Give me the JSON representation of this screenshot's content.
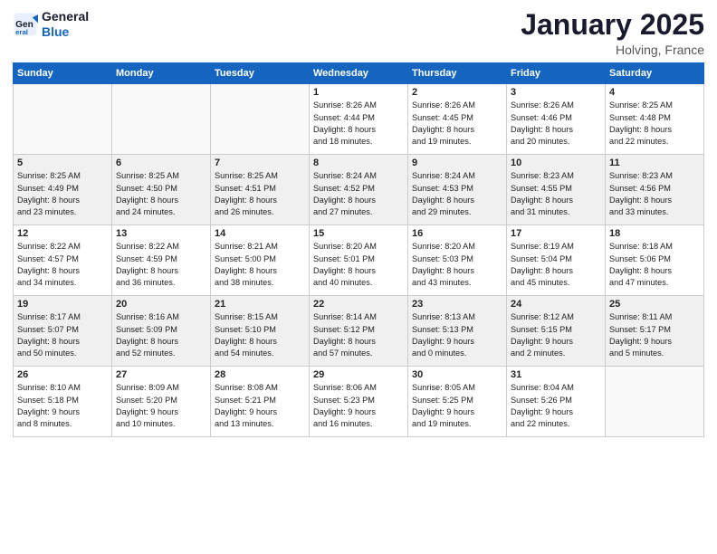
{
  "logo": {
    "line1": "General",
    "line2": "Blue"
  },
  "title": "January 2025",
  "location": "Holving, France",
  "headers": [
    "Sunday",
    "Monday",
    "Tuesday",
    "Wednesday",
    "Thursday",
    "Friday",
    "Saturday"
  ],
  "weeks": [
    {
      "shaded": false,
      "days": [
        {
          "num": "",
          "info": ""
        },
        {
          "num": "",
          "info": ""
        },
        {
          "num": "",
          "info": ""
        },
        {
          "num": "1",
          "info": "Sunrise: 8:26 AM\nSunset: 4:44 PM\nDaylight: 8 hours\nand 18 minutes."
        },
        {
          "num": "2",
          "info": "Sunrise: 8:26 AM\nSunset: 4:45 PM\nDaylight: 8 hours\nand 19 minutes."
        },
        {
          "num": "3",
          "info": "Sunrise: 8:26 AM\nSunset: 4:46 PM\nDaylight: 8 hours\nand 20 minutes."
        },
        {
          "num": "4",
          "info": "Sunrise: 8:25 AM\nSunset: 4:48 PM\nDaylight: 8 hours\nand 22 minutes."
        }
      ]
    },
    {
      "shaded": true,
      "days": [
        {
          "num": "5",
          "info": "Sunrise: 8:25 AM\nSunset: 4:49 PM\nDaylight: 8 hours\nand 23 minutes."
        },
        {
          "num": "6",
          "info": "Sunrise: 8:25 AM\nSunset: 4:50 PM\nDaylight: 8 hours\nand 24 minutes."
        },
        {
          "num": "7",
          "info": "Sunrise: 8:25 AM\nSunset: 4:51 PM\nDaylight: 8 hours\nand 26 minutes."
        },
        {
          "num": "8",
          "info": "Sunrise: 8:24 AM\nSunset: 4:52 PM\nDaylight: 8 hours\nand 27 minutes."
        },
        {
          "num": "9",
          "info": "Sunrise: 8:24 AM\nSunset: 4:53 PM\nDaylight: 8 hours\nand 29 minutes."
        },
        {
          "num": "10",
          "info": "Sunrise: 8:23 AM\nSunset: 4:55 PM\nDaylight: 8 hours\nand 31 minutes."
        },
        {
          "num": "11",
          "info": "Sunrise: 8:23 AM\nSunset: 4:56 PM\nDaylight: 8 hours\nand 33 minutes."
        }
      ]
    },
    {
      "shaded": false,
      "days": [
        {
          "num": "12",
          "info": "Sunrise: 8:22 AM\nSunset: 4:57 PM\nDaylight: 8 hours\nand 34 minutes."
        },
        {
          "num": "13",
          "info": "Sunrise: 8:22 AM\nSunset: 4:59 PM\nDaylight: 8 hours\nand 36 minutes."
        },
        {
          "num": "14",
          "info": "Sunrise: 8:21 AM\nSunset: 5:00 PM\nDaylight: 8 hours\nand 38 minutes."
        },
        {
          "num": "15",
          "info": "Sunrise: 8:20 AM\nSunset: 5:01 PM\nDaylight: 8 hours\nand 40 minutes."
        },
        {
          "num": "16",
          "info": "Sunrise: 8:20 AM\nSunset: 5:03 PM\nDaylight: 8 hours\nand 43 minutes."
        },
        {
          "num": "17",
          "info": "Sunrise: 8:19 AM\nSunset: 5:04 PM\nDaylight: 8 hours\nand 45 minutes."
        },
        {
          "num": "18",
          "info": "Sunrise: 8:18 AM\nSunset: 5:06 PM\nDaylight: 8 hours\nand 47 minutes."
        }
      ]
    },
    {
      "shaded": true,
      "days": [
        {
          "num": "19",
          "info": "Sunrise: 8:17 AM\nSunset: 5:07 PM\nDaylight: 8 hours\nand 50 minutes."
        },
        {
          "num": "20",
          "info": "Sunrise: 8:16 AM\nSunset: 5:09 PM\nDaylight: 8 hours\nand 52 minutes."
        },
        {
          "num": "21",
          "info": "Sunrise: 8:15 AM\nSunset: 5:10 PM\nDaylight: 8 hours\nand 54 minutes."
        },
        {
          "num": "22",
          "info": "Sunrise: 8:14 AM\nSunset: 5:12 PM\nDaylight: 8 hours\nand 57 minutes."
        },
        {
          "num": "23",
          "info": "Sunrise: 8:13 AM\nSunset: 5:13 PM\nDaylight: 9 hours\nand 0 minutes."
        },
        {
          "num": "24",
          "info": "Sunrise: 8:12 AM\nSunset: 5:15 PM\nDaylight: 9 hours\nand 2 minutes."
        },
        {
          "num": "25",
          "info": "Sunrise: 8:11 AM\nSunset: 5:17 PM\nDaylight: 9 hours\nand 5 minutes."
        }
      ]
    },
    {
      "shaded": false,
      "days": [
        {
          "num": "26",
          "info": "Sunrise: 8:10 AM\nSunset: 5:18 PM\nDaylight: 9 hours\nand 8 minutes."
        },
        {
          "num": "27",
          "info": "Sunrise: 8:09 AM\nSunset: 5:20 PM\nDaylight: 9 hours\nand 10 minutes."
        },
        {
          "num": "28",
          "info": "Sunrise: 8:08 AM\nSunset: 5:21 PM\nDaylight: 9 hours\nand 13 minutes."
        },
        {
          "num": "29",
          "info": "Sunrise: 8:06 AM\nSunset: 5:23 PM\nDaylight: 9 hours\nand 16 minutes."
        },
        {
          "num": "30",
          "info": "Sunrise: 8:05 AM\nSunset: 5:25 PM\nDaylight: 9 hours\nand 19 minutes."
        },
        {
          "num": "31",
          "info": "Sunrise: 8:04 AM\nSunset: 5:26 PM\nDaylight: 9 hours\nand 22 minutes."
        },
        {
          "num": "",
          "info": ""
        }
      ]
    }
  ]
}
